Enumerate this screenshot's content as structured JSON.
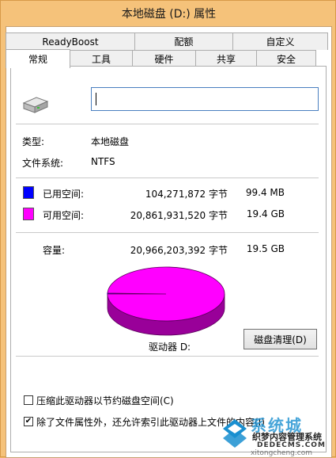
{
  "window": {
    "title": "本地磁盘 (D:) 属性"
  },
  "tabs_row1": [
    {
      "label": "ReadyBoost"
    },
    {
      "label": "配额"
    },
    {
      "label": "自定义"
    }
  ],
  "tabs_row2": [
    {
      "label": "常规",
      "active": true
    },
    {
      "label": "工具"
    },
    {
      "label": "硬件"
    },
    {
      "label": "共享"
    },
    {
      "label": "安全"
    }
  ],
  "general": {
    "drive_icon": "hard-drive-icon",
    "name_value": "",
    "type_label": "类型:",
    "type_value": "本地磁盘",
    "fs_label": "文件系统:",
    "fs_value": "NTFS",
    "used": {
      "label": "已用空间:",
      "bytes": "104,271,872 字节",
      "size": "99.4 MB",
      "color": "#0000ff"
    },
    "free": {
      "label": "可用空间:",
      "bytes": "20,861,931,520 字节",
      "size": "19.4 GB",
      "color": "#ff00ff"
    },
    "capacity": {
      "label": "容量:",
      "bytes": "20,966,203,392 字节",
      "size": "19.5 GB"
    },
    "drive_label": "驱动器 D:",
    "cleanup_button": "磁盘清理(D)",
    "compress_label": "压缩此驱动器以节约磁盘空间(C)",
    "compress_checked": false,
    "index_label": "除了文件属性外，还允许索引此驱动器上文件的内容(I)",
    "index_checked": true
  },
  "chart_data": {
    "type": "pie",
    "categories": [
      "已用空间",
      "可用空间"
    ],
    "values": [
      104271872,
      20861931520
    ],
    "colors": [
      "#0000ff",
      "#ff00ff"
    ]
  },
  "watermark": {
    "line1": "系统城",
    "line2": "织梦内容管理系统",
    "line3": "DEDECMS.COM",
    "line4": "xitongcheng.com"
  }
}
